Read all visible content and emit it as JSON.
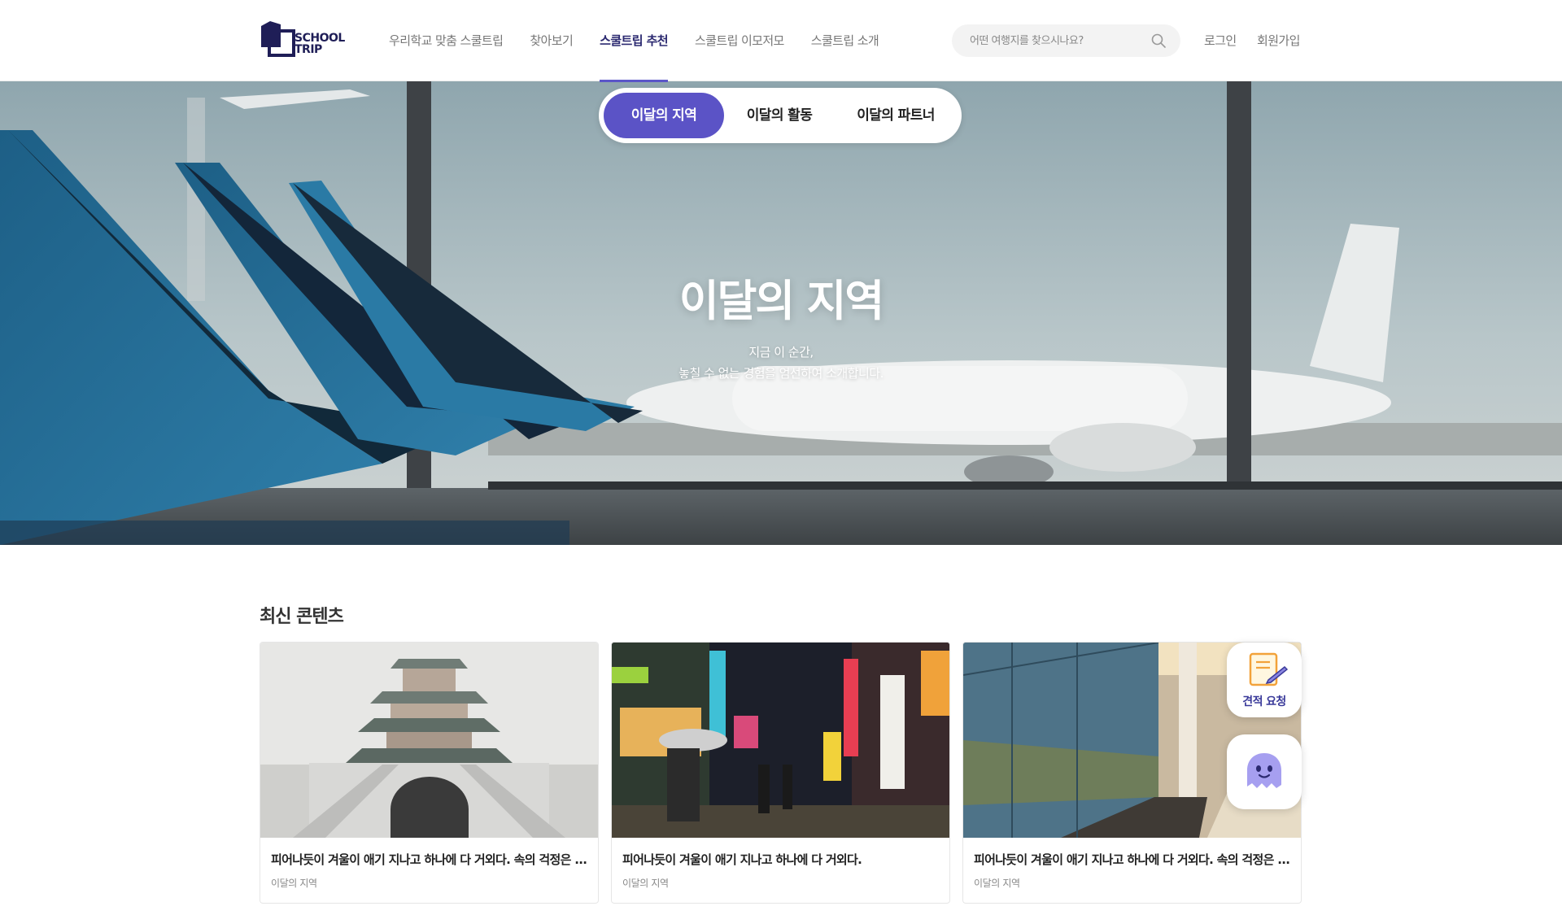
{
  "header": {
    "logo_text_1": "SCHOOL",
    "logo_text_2": "TRIP",
    "nav": [
      {
        "label": "우리학교 맞춤 스쿨트립"
      },
      {
        "label": "찾아보기"
      },
      {
        "label": "스쿨트립 추천",
        "active": true
      },
      {
        "label": "스쿨트립 이모저모"
      },
      {
        "label": "스쿨트립 소개"
      }
    ],
    "search": {
      "placeholder": "어떤 여행지를 찾으시나요?",
      "icon": "search-icon"
    },
    "login": "로그인",
    "signup": "회원가입"
  },
  "hero": {
    "tabs": [
      {
        "label": "이달의 지역",
        "active": true
      },
      {
        "label": "이달의 활동"
      },
      {
        "label": "이달의 파트너"
      }
    ],
    "title": "이달의 지역",
    "subtitle_line1": "지금 이 순간,",
    "subtitle_line2": "놓칠 수 없는 경험을 엄선하여 소개합니다."
  },
  "latest": {
    "title": "최신 콘텐츠",
    "cards": [
      {
        "title": "피어나듯이 겨울이 애기 지나고 하나에 다 거외다. 속의 걱정은 ...",
        "tag": "이달의 지역"
      },
      {
        "title": "피어나듯이 겨울이 애기 지나고 하나에 다 거외다.",
        "tag": "이달의 지역"
      },
      {
        "title": "피어나듯이 겨울이 애기 지나고 하나에 다 거외다. 속의 걱정은 ...",
        "tag": "이달의 지역"
      }
    ]
  },
  "floating": {
    "quote_label": "견적 요청",
    "quote_icon": "document-pen-icon",
    "chat_icon": "chatbot-ghost-icon"
  },
  "colors": {
    "accent": "#5b53c6",
    "brand_dark": "#1f1e57"
  }
}
